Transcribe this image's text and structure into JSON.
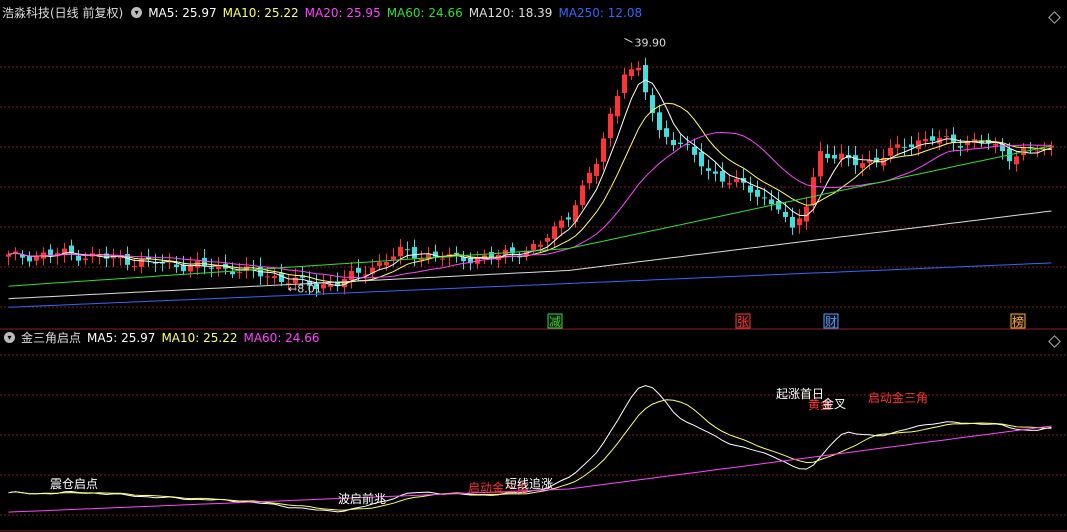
{
  "main_panel": {
    "title": "浩淼科技(日线 前复权)",
    "indicators": [
      {
        "label": "MA5: 25.97",
        "color": "#ffffff"
      },
      {
        "label": "MA10: 25.22",
        "color": "#ffff66"
      },
      {
        "label": "MA20: 25.95",
        "color": "#ff44ff"
      },
      {
        "label": "MA60: 24.66",
        "color": "#33dd33"
      },
      {
        "label": "MA120: 18.39",
        "color": "#dddddd"
      },
      {
        "label": "MA250: 12.08",
        "color": "#3366ff"
      }
    ],
    "high_label": "39.90",
    "low_label": "8.01",
    "events": [
      {
        "text": "减",
        "color": "#33dd33"
      },
      {
        "text": "张",
        "color": "#ff3333"
      },
      {
        "text": "财",
        "color": "#5599ff"
      },
      {
        "text": "榜",
        "color": "#ffaa33"
      }
    ]
  },
  "sub_panel": {
    "title": "金三角启点",
    "indicators": [
      {
        "label": "MA5: 25.97",
        "color": "#ffffff"
      },
      {
        "label": "MA10: 25.22",
        "color": "#ffff66"
      },
      {
        "label": "MA60: 24.66",
        "color": "#ff44ff"
      }
    ],
    "annotations": [
      {
        "text": "震仓启点",
        "color": "#ffffff"
      },
      {
        "text": "波启前兆",
        "color": "#ffffff"
      },
      {
        "text": "启动金三角",
        "color": "#ff3333"
      },
      {
        "text": "短线追涨",
        "color": "#ffffff"
      },
      {
        "text": "起涨首日",
        "color": "#ffffff"
      },
      {
        "text": "黄金",
        "color": "#ff3333"
      },
      {
        "text": "金叉",
        "color": "#ffffff"
      },
      {
        "text": "启动金三角",
        "color": "#ff3333"
      }
    ]
  },
  "chart_data": {
    "type": "candlestick",
    "title": "浩淼科技(日线 前复权)",
    "high": 39.9,
    "low": 8.01,
    "y_min": 5,
    "y_max": 42,
    "series": [
      "MA5",
      "MA10",
      "MA20",
      "MA60",
      "MA120",
      "MA250"
    ]
  },
  "colors": {
    "up": "#ff3333",
    "down": "#44dddd",
    "grid": "#7a1e1e",
    "bg": "#000000"
  }
}
